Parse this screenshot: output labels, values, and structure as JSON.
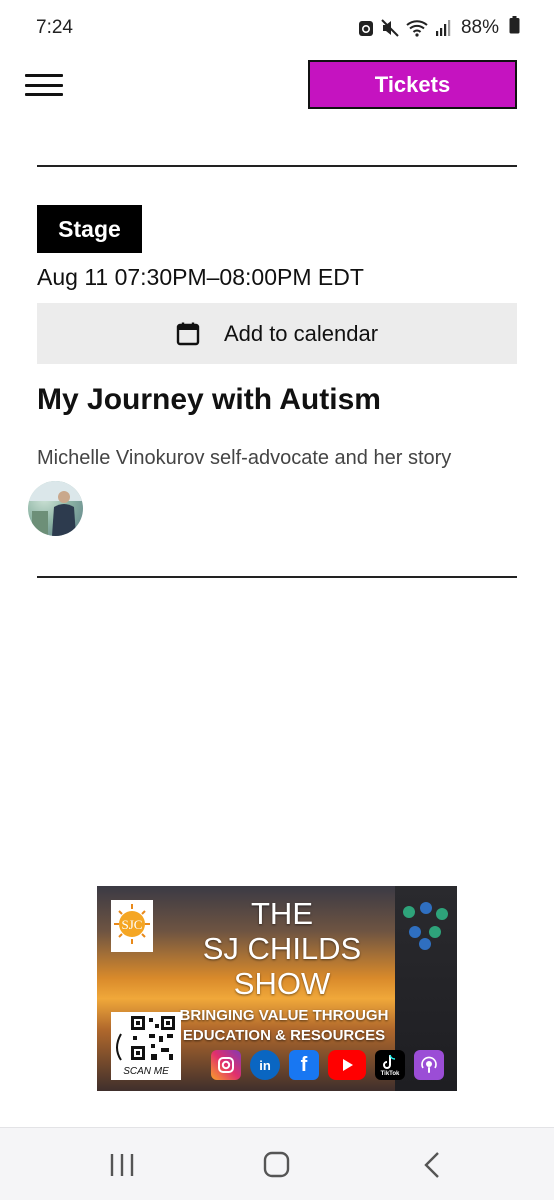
{
  "status_bar": {
    "time": "7:24",
    "battery": "88%",
    "icons": [
      "recycle-icon",
      "mute-icon",
      "wifi-icon",
      "signal-icon",
      "battery-icon"
    ]
  },
  "header": {
    "menu_icon": "hamburger-menu-icon",
    "tickets_label": "Tickets",
    "tickets_color": "#c513c0"
  },
  "event": {
    "stage_label": "Stage",
    "time_text": "Aug 11 07:30PM–08:00PM EDT",
    "calendar_label": "Add to calendar",
    "calendar_icon": "calendar-icon",
    "title": "My Journey with Autism",
    "description": "Michelle Vinokurov self-advocate and her story"
  },
  "banner": {
    "title": "THE SJ CHILDS SHOW",
    "title_line1": "THE",
    "title_line2": "SJ CHILDS",
    "title_line3": "SHOW",
    "tagline_line1": "BRINGING VALUE THROUGH",
    "tagline_line2": "EDUCATION & RESOURCES",
    "logo_text": "SJC",
    "scan_label": "SCAN ME",
    "social": [
      {
        "name": "instagram-icon",
        "color": "#c13584"
      },
      {
        "name": "linkedin-icon",
        "color": "#0a66c2",
        "text": "in"
      },
      {
        "name": "facebook-icon",
        "color": "#1877f2",
        "text": "f"
      },
      {
        "name": "youtube-icon",
        "color": "#ff0000"
      },
      {
        "name": "tiktok-icon",
        "color": "#000000",
        "text": "TikTok"
      },
      {
        "name": "podcast-icon",
        "color": "#9b4dd6"
      }
    ]
  },
  "nav_bar": {
    "buttons": [
      "recent-apps-icon",
      "home-icon",
      "back-icon"
    ]
  }
}
